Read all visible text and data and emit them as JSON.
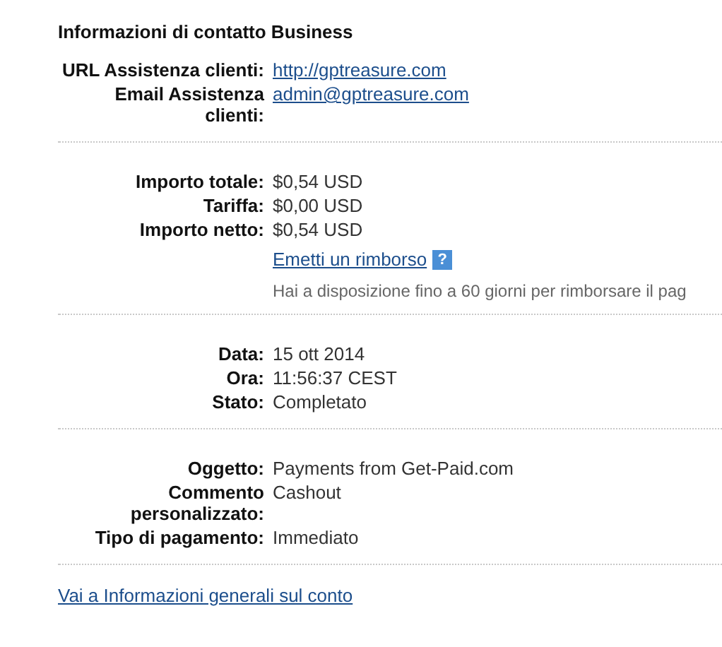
{
  "title": "Informazioni di contatto Business",
  "sections": [
    {
      "rows": [
        {
          "label": "URL Assistenza clienti:",
          "value": "http://gptreasure.com",
          "kind": "link"
        },
        {
          "label": "Email Assistenza clienti:",
          "value": "admin@gptreasure.com",
          "kind": "link"
        }
      ]
    },
    {
      "rows": [
        {
          "label": "Importo totale:",
          "value": "$0,54 USD",
          "kind": "text"
        },
        {
          "label": "Tariffa:",
          "value": "$0,00 USD",
          "kind": "text"
        },
        {
          "label": "Importo netto:",
          "value": "$0,54 USD",
          "kind": "text"
        }
      ],
      "refund": {
        "link": "Emetti un rimborso",
        "help": "?",
        "note": "Hai a disposizione fino a 60 giorni per rimborsare il pag"
      }
    },
    {
      "rows": [
        {
          "label": "Data:",
          "value": "15 ott 2014",
          "kind": "text"
        },
        {
          "label": "Ora:",
          "value": "11:56:37 CEST",
          "kind": "text"
        },
        {
          "label": "Stato:",
          "value": "Completato",
          "kind": "text"
        }
      ]
    },
    {
      "rows": [
        {
          "label": "Oggetto:",
          "value": "Payments from Get-Paid.com",
          "kind": "text"
        },
        {
          "label": "Commento personalizzato:",
          "value": "Cashout",
          "kind": "text"
        },
        {
          "label": "Tipo di pagamento:",
          "value": "Immediato",
          "kind": "text"
        }
      ]
    }
  ],
  "footer_link": "Vai a Informazioni generali sul conto"
}
